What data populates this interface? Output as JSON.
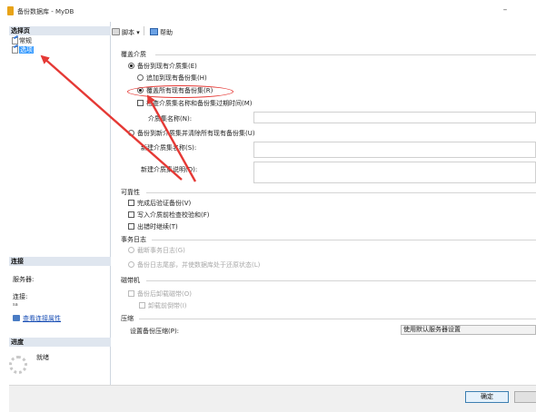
{
  "window": {
    "title": "备份数据库 - MyDB",
    "minimize_label": "–"
  },
  "sidebar": {
    "select_page_header": "选择页",
    "pages": [
      {
        "label": "常规"
      },
      {
        "label": "选项"
      }
    ],
    "connection_header": "连接",
    "server_label": "服务器:",
    "server_value": "",
    "connection_label": "连接:",
    "connection_value": "sa",
    "view_connection_link": "查看连接属性",
    "progress_header": "进度",
    "progress_status": "就绪"
  },
  "toolbar": {
    "script_label": "脚本",
    "help_label": "帮助"
  },
  "overwrite": {
    "section_title": "覆盖介质",
    "backup_existing": "备份到现有介质集(E)",
    "append": "追加到现有备份集(H)",
    "overwrite_all": "覆盖所有现有备份集(R)",
    "check_name_expiry": "检查介质集名称和备份集过期时间(M)",
    "media_set_name": "介质集名称(N):",
    "backup_new": "备份到新介质集并清除所有现有备份集(U)",
    "new_media_set_name": "新建介质集名称(S):",
    "new_media_set_desc": "新建介质集说明(D):"
  },
  "reliability": {
    "section_title": "可靠性",
    "verify": "完成后验证备份(V)",
    "checksum": "写入介质前检查校验和(F)",
    "continue_on_error": "出错时继续(T)"
  },
  "transaction_log": {
    "section_title": "事务日志",
    "truncate": "截断事务日志(G)",
    "tail_log": "备份日志尾部，并使数据库处于还原状态(L)"
  },
  "tape": {
    "section_title": "磁带机",
    "unload": "备份后卸载磁带(O)",
    "rewind": "卸载前倒带(I)"
  },
  "compression": {
    "section_title": "压缩",
    "setting_label": "设置备份压缩(P):",
    "selected_value": "使用默认服务器设置"
  },
  "buttons": {
    "ok": "确定"
  },
  "colors": {
    "annotation": "#e53935",
    "selection": "#3399ff"
  }
}
